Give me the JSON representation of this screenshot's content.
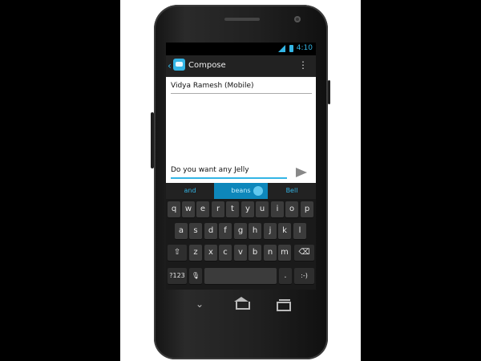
{
  "status_bar": {
    "time": "4:10"
  },
  "action_bar": {
    "title": "Compose"
  },
  "compose": {
    "recipient": "Vidya Ramesh (Mobile)",
    "message": "Do you want any Jelly"
  },
  "suggestions": [
    "and",
    "beans",
    "Bell"
  ],
  "keyboard": {
    "row1": [
      "q",
      "w",
      "e",
      "r",
      "t",
      "y",
      "u",
      "i",
      "o",
      "p"
    ],
    "row2": [
      "a",
      "s",
      "d",
      "f",
      "g",
      "h",
      "j",
      "k",
      "l"
    ],
    "row3": [
      "z",
      "x",
      "c",
      "v",
      "b",
      "n",
      "m"
    ],
    "shift_glyph": "⇧",
    "delete_glyph": "⌫",
    "symbols_label": "?123",
    "mic_glyph": "🎙",
    "period_label": ".",
    "emoji_label": ":-)"
  },
  "nav": {
    "back_glyph": "⌄"
  },
  "colors": {
    "accent": "#33b5e5"
  }
}
